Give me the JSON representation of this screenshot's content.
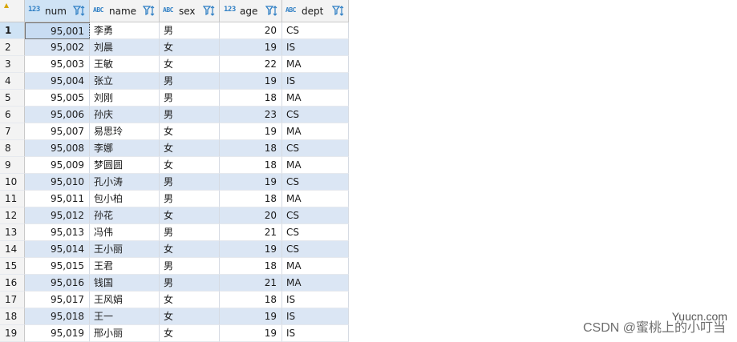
{
  "columns": [
    {
      "name": "num",
      "type_icon": "123"
    },
    {
      "name": "name",
      "type_icon": "ABC"
    },
    {
      "name": "sex",
      "type_icon": "ABC"
    },
    {
      "name": "age",
      "type_icon": "123"
    },
    {
      "name": "dept",
      "type_icon": "ABC"
    }
  ],
  "rows": [
    {
      "rn": "1",
      "num": "95,001",
      "name": "李勇",
      "sex": "男",
      "age": "20",
      "dept": "CS"
    },
    {
      "rn": "2",
      "num": "95,002",
      "name": "刘晨",
      "sex": "女",
      "age": "19",
      "dept": "IS"
    },
    {
      "rn": "3",
      "num": "95,003",
      "name": "王敏",
      "sex": "女",
      "age": "22",
      "dept": "MA"
    },
    {
      "rn": "4",
      "num": "95,004",
      "name": "张立",
      "sex": "男",
      "age": "19",
      "dept": "IS"
    },
    {
      "rn": "5",
      "num": "95,005",
      "name": "刘刚",
      "sex": "男",
      "age": "18",
      "dept": "MA"
    },
    {
      "rn": "6",
      "num": "95,006",
      "name": "孙庆",
      "sex": "男",
      "age": "23",
      "dept": "CS"
    },
    {
      "rn": "7",
      "num": "95,007",
      "name": "易思玲",
      "sex": "女",
      "age": "19",
      "dept": "MA"
    },
    {
      "rn": "8",
      "num": "95,008",
      "name": "李娜",
      "sex": "女",
      "age": "18",
      "dept": "CS"
    },
    {
      "rn": "9",
      "num": "95,009",
      "name": "梦圆圆",
      "sex": "女",
      "age": "18",
      "dept": "MA"
    },
    {
      "rn": "10",
      "num": "95,010",
      "name": "孔小涛",
      "sex": "男",
      "age": "19",
      "dept": "CS"
    },
    {
      "rn": "11",
      "num": "95,011",
      "name": "包小柏",
      "sex": "男",
      "age": "18",
      "dept": "MA"
    },
    {
      "rn": "12",
      "num": "95,012",
      "name": "孙花",
      "sex": "女",
      "age": "20",
      "dept": "CS"
    },
    {
      "rn": "13",
      "num": "95,013",
      "name": "冯伟",
      "sex": "男",
      "age": "21",
      "dept": "CS"
    },
    {
      "rn": "14",
      "num": "95,014",
      "name": "王小丽",
      "sex": "女",
      "age": "19",
      "dept": "CS"
    },
    {
      "rn": "15",
      "num": "95,015",
      "name": "王君",
      "sex": "男",
      "age": "18",
      "dept": "MA"
    },
    {
      "rn": "16",
      "num": "95,016",
      "name": "钱国",
      "sex": "男",
      "age": "21",
      "dept": "MA"
    },
    {
      "rn": "17",
      "num": "95,017",
      "name": "王风娟",
      "sex": "女",
      "age": "18",
      "dept": "IS"
    },
    {
      "rn": "18",
      "num": "95,018",
      "name": "王一",
      "sex": "女",
      "age": "19",
      "dept": "IS"
    },
    {
      "rn": "19",
      "num": "95,019",
      "name": "邢小丽",
      "sex": "女",
      "age": "19",
      "dept": "IS"
    }
  ],
  "watermark": {
    "csdn": "CSDN @蜜桃上的小叮当",
    "site": "Yuucn.com"
  },
  "colors": {
    "alt_row": "#dbe6f4",
    "selected_header": "#cfe3f5",
    "type_icon": "#2f7fc4"
  }
}
